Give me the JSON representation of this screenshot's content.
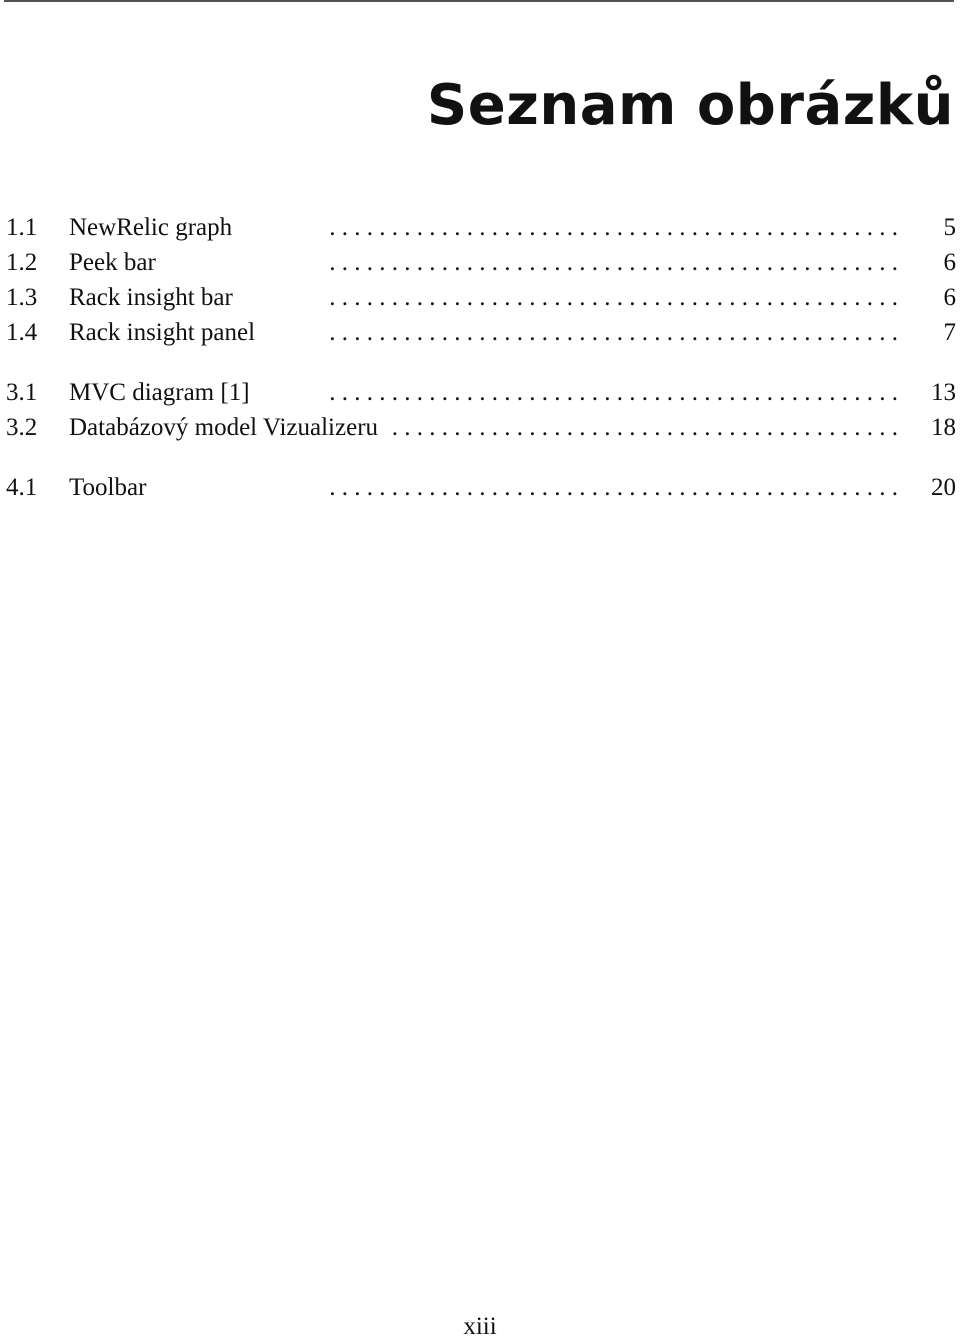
{
  "heading": "Seznam obrázků",
  "groups": [
    {
      "entries": [
        {
          "number": "1.1",
          "title": "NewRelic graph",
          "page": "5"
        },
        {
          "number": "1.2",
          "title": "Peek bar",
          "page": "6"
        },
        {
          "number": "1.3",
          "title": "Rack insight bar",
          "page": "6"
        },
        {
          "number": "1.4",
          "title": "Rack insight panel",
          "page": "7"
        }
      ]
    },
    {
      "entries": [
        {
          "number": "3.1",
          "title": "MVC diagram [1]",
          "page": "13"
        },
        {
          "number": "3.2",
          "title": "Databázový model Vizualizeru",
          "page": "18"
        }
      ]
    },
    {
      "entries": [
        {
          "number": "4.1",
          "title": "Toolbar",
          "page": "20"
        }
      ]
    }
  ],
  "leader_dots": ". . . . . . . . . . . . . . . . . . . . . . . . . . . . . . . . . . . . . . . . . . . . . .",
  "folio": "xiii"
}
